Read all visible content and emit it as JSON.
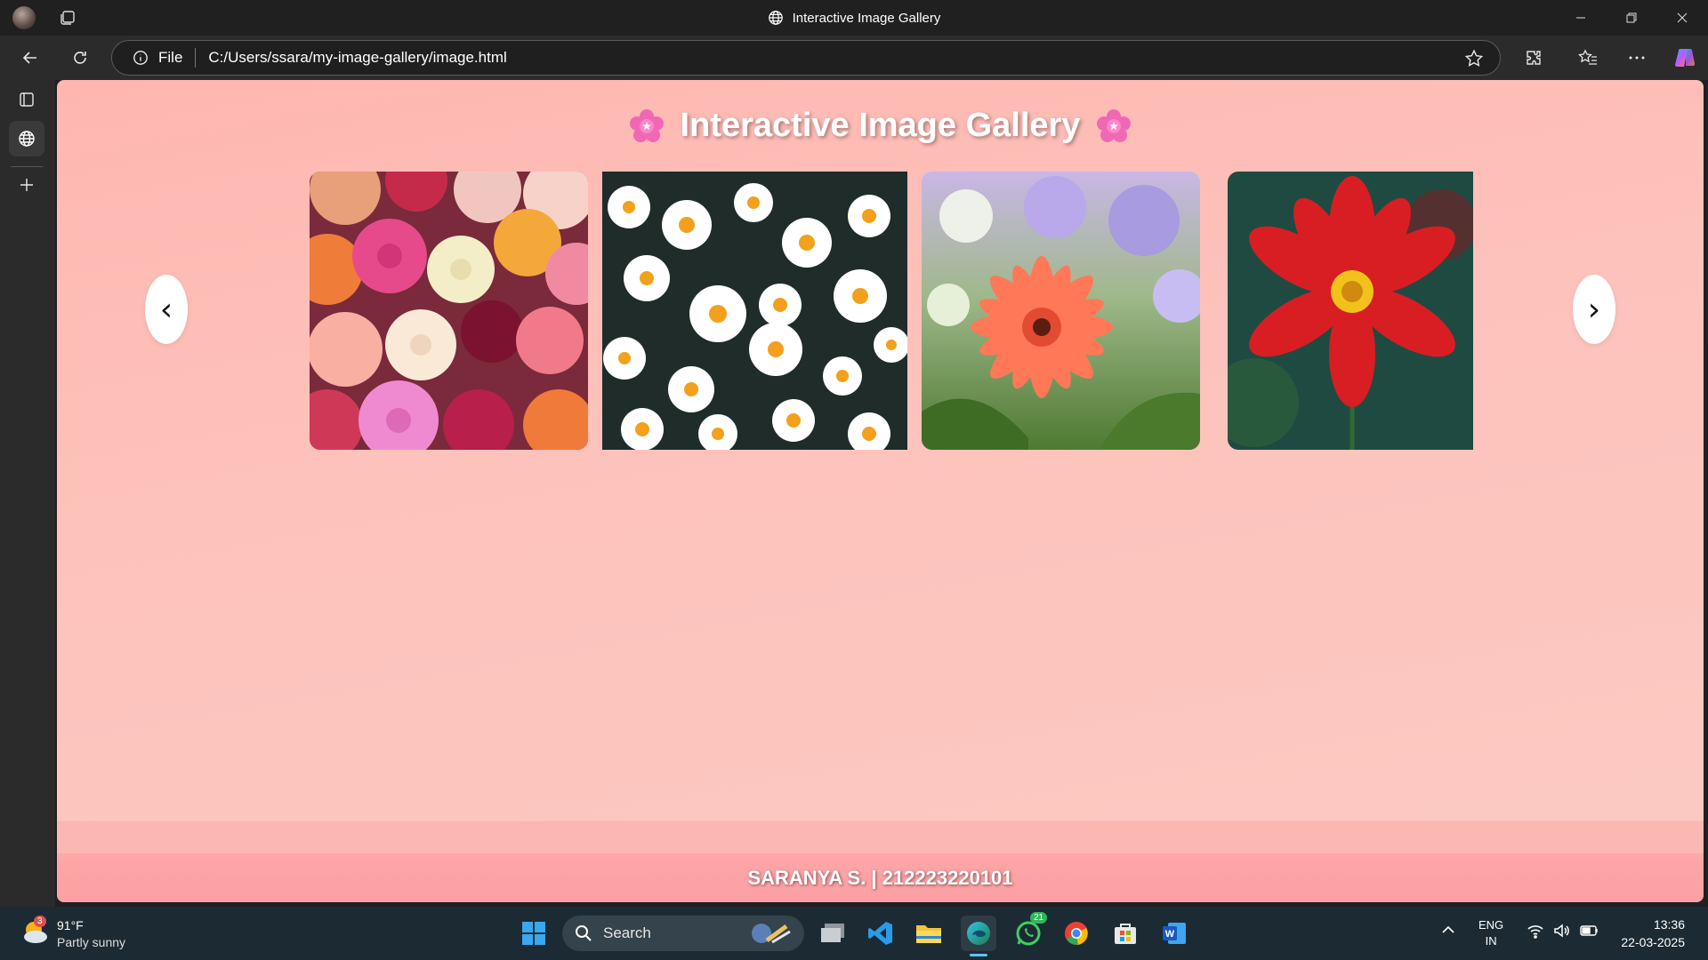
{
  "window": {
    "title": "Interactive Image Gallery"
  },
  "address_bar": {
    "scheme_label": "File",
    "url": "C:/Users/ssara/my-image-gallery/image.html"
  },
  "page": {
    "heading": "Interactive Image Gallery",
    "prev_arrow": "‹",
    "next_arrow": "›",
    "images": [
      "roses",
      "daisies",
      "gerbera",
      "red-dahlia"
    ],
    "footer_credit": "SARANYA S. | 212223220101"
  },
  "taskbar": {
    "weather_temp": "91°F",
    "weather_desc": "Partly sunny",
    "weather_badge": "3",
    "search_label": "Search",
    "whatsapp_badge": "21",
    "lang_top": "ENG",
    "lang_bottom": "IN",
    "time": "13:36",
    "date": "22-03-2025"
  },
  "colors": {
    "page_bg": "#fdc2bb",
    "footer_bg": "#fda4a6",
    "taskbar_bg": "#1c2b33"
  }
}
